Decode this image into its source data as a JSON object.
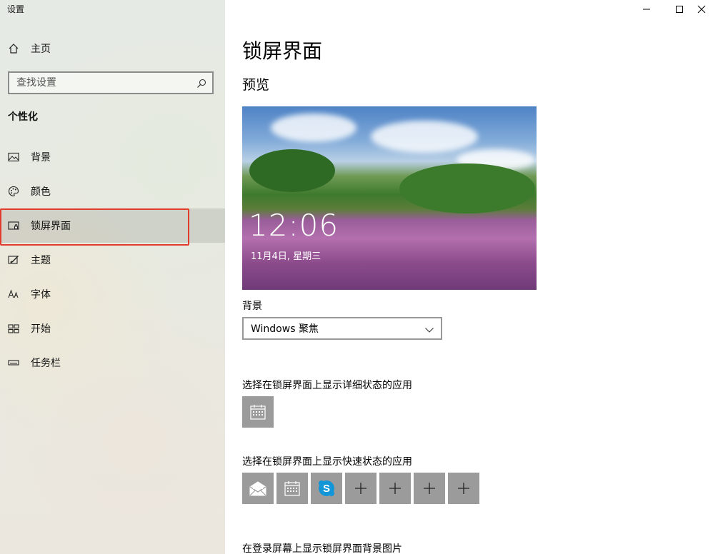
{
  "window": {
    "title": "设置",
    "controls": {
      "minimize": "minimize-icon",
      "maximize": "maximize-icon",
      "close": "close-icon"
    }
  },
  "sidebar": {
    "home_label": "主页",
    "search_placeholder": "查找设置",
    "section_title": "个性化",
    "items": [
      {
        "label": "背景",
        "icon": "picture-icon"
      },
      {
        "label": "颜色",
        "icon": "palette-icon"
      },
      {
        "label": "锁屏界面",
        "icon": "lock-screen-icon",
        "selected": true
      },
      {
        "label": "主题",
        "icon": "theme-icon"
      },
      {
        "label": "字体",
        "icon": "font-icon"
      },
      {
        "label": "开始",
        "icon": "start-icon"
      },
      {
        "label": "任务栏",
        "icon": "taskbar-icon"
      }
    ]
  },
  "main": {
    "title": "锁屏界面",
    "preview_heading": "预览",
    "preview": {
      "time": "12:06",
      "date": "11月4日, 星期三"
    },
    "background_label": "背景",
    "background_value": "Windows 聚焦",
    "detailed_status_label": "选择在锁屏界面上显示详细状态的应用",
    "quick_status_label": "选择在锁屏界面上显示快速状态的应用",
    "signin_bg_label": "在登录屏幕上显示锁屏界面背景图片",
    "detailed_apps": [
      "calendar-icon"
    ],
    "quick_apps": [
      "mail-icon",
      "calendar-icon",
      "skype-icon",
      "add-icon",
      "add-icon",
      "add-icon",
      "add-icon"
    ]
  },
  "colors": {
    "selection_outline": "#e23a2c",
    "tile_bg": "#9b9b9b",
    "skype_blue": "#1296d8"
  }
}
